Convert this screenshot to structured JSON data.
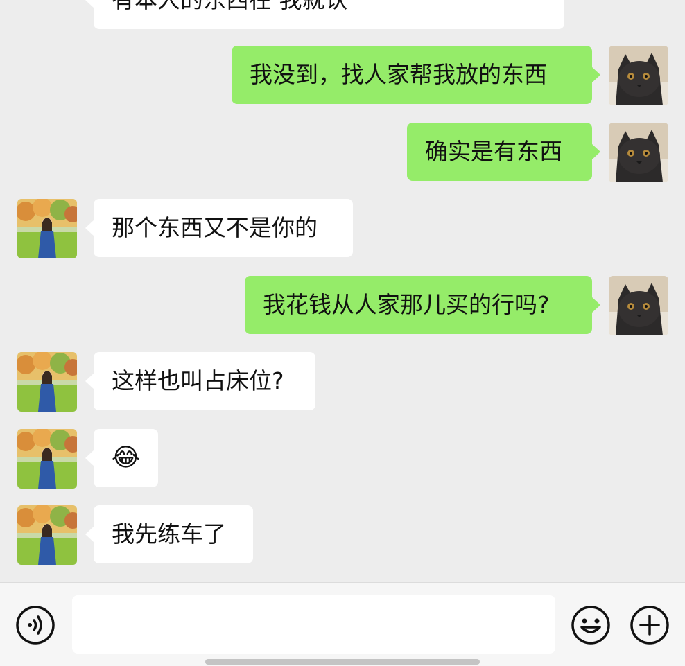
{
  "messages": [
    {
      "side": "in",
      "text": "有本人的东西在 我就认"
    },
    {
      "side": "out",
      "text": "我没到，找人家帮我放的东西"
    },
    {
      "side": "out",
      "text": "确实是有东西"
    },
    {
      "side": "in",
      "text": "那个东西又不是你的"
    },
    {
      "side": "out",
      "text": "我花钱从人家那儿买的行吗?"
    },
    {
      "side": "in",
      "text": "这样也叫占床位?"
    },
    {
      "side": "in",
      "text": "😂"
    },
    {
      "side": "in",
      "text": "我先练车了"
    }
  ],
  "input_bar": {
    "voice_icon": "voice-icon",
    "emoji_icon": "emoji-icon",
    "plus_icon": "plus-icon",
    "input_value": ""
  },
  "watermark": "\u0000",
  "colors": {
    "background": "#ededed",
    "outgoing_bubble": "#95ec69",
    "incoming_bubble": "#ffffff"
  }
}
